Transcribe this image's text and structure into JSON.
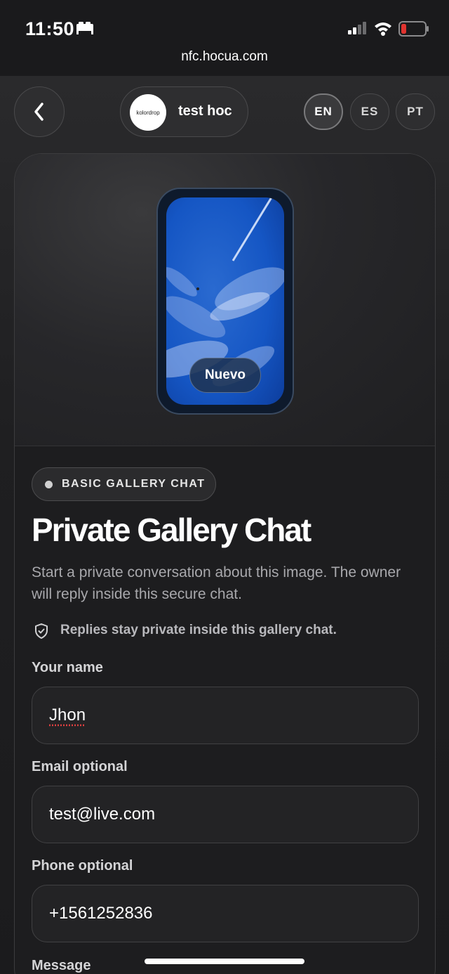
{
  "status_bar": {
    "time": "11:50",
    "url": "nfc.hocua.com",
    "icons": [
      "bed-icon",
      "signal-icon",
      "wifi-icon",
      "battery-icon"
    ]
  },
  "header": {
    "back_icon": "chevron-left-icon",
    "brand": {
      "logo_text": "kolordrop",
      "name": "test hoc"
    },
    "languages": [
      {
        "code": "EN",
        "active": true
      },
      {
        "code": "ES",
        "active": false
      },
      {
        "code": "PT",
        "active": false
      }
    ]
  },
  "hero": {
    "badge": "Nuevo"
  },
  "content": {
    "tag": "BASIC GALLERY CHAT",
    "title": "Private Gallery Chat",
    "description": "Start a private conversation about this image. The owner will reply inside this secure chat.",
    "privacy_note": "Replies stay private inside this gallery chat."
  },
  "form": {
    "name_label": "Your name",
    "name_value": "Jhon",
    "email_label": "Email optional",
    "email_value": "test@live.com",
    "phone_label": "Phone optional",
    "phone_value": "+1561252836",
    "message_label": "Message"
  },
  "colors": {
    "background": "#1c1c1e",
    "card": "#1d1d1f",
    "battery_low": "#e0332f"
  }
}
